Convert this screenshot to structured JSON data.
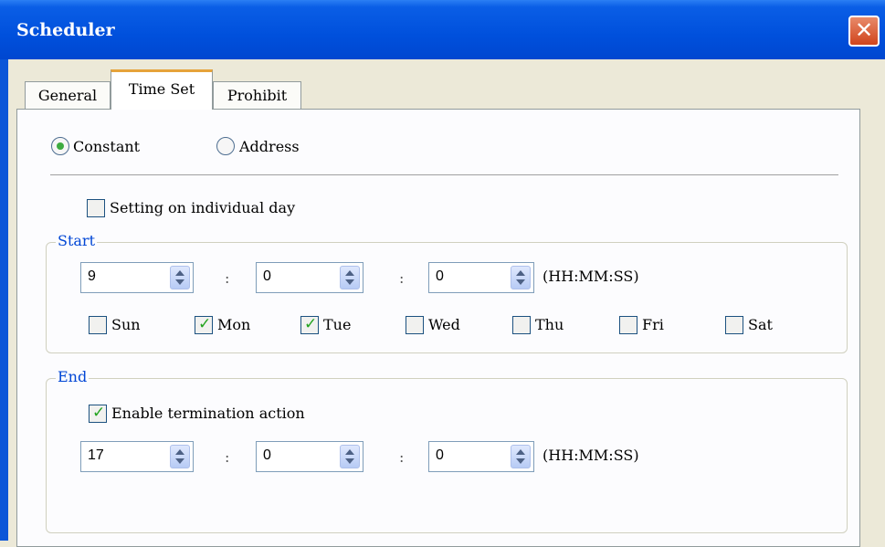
{
  "window": {
    "title": "Scheduler",
    "close_glyph": "✕"
  },
  "tabs": [
    {
      "label": "General",
      "active": false
    },
    {
      "label": "Time Set",
      "active": true
    },
    {
      "label": "Prohibit",
      "active": false
    }
  ],
  "mode": {
    "options": [
      {
        "label": "Constant",
        "selected": true
      },
      {
        "label": "Address",
        "selected": false
      }
    ]
  },
  "individual_day": {
    "label": "Setting on individual day",
    "checked": false
  },
  "start": {
    "title": "Start",
    "hour": "9",
    "minute": "0",
    "second": "0",
    "separator": ":",
    "format": "(HH:MM:SS)",
    "days": [
      {
        "label": "Sun",
        "checked": false
      },
      {
        "label": "Mon",
        "checked": true
      },
      {
        "label": "Tue",
        "checked": true
      },
      {
        "label": "Wed",
        "checked": false
      },
      {
        "label": "Thu",
        "checked": false
      },
      {
        "label": "Fri",
        "checked": false
      },
      {
        "label": "Sat",
        "checked": false
      }
    ]
  },
  "end": {
    "title": "End",
    "enable_label": "Enable termination action",
    "enable_checked": true,
    "hour": "17",
    "minute": "0",
    "second": "0",
    "separator": ":",
    "format": "(HH:MM:SS)"
  },
  "colors": {
    "titlebar": "#0050dc",
    "check": "#22a31d",
    "radio_dot": "#3eab40",
    "group_title": "#0046d5",
    "active_tab_accent": "#e6a33a"
  }
}
